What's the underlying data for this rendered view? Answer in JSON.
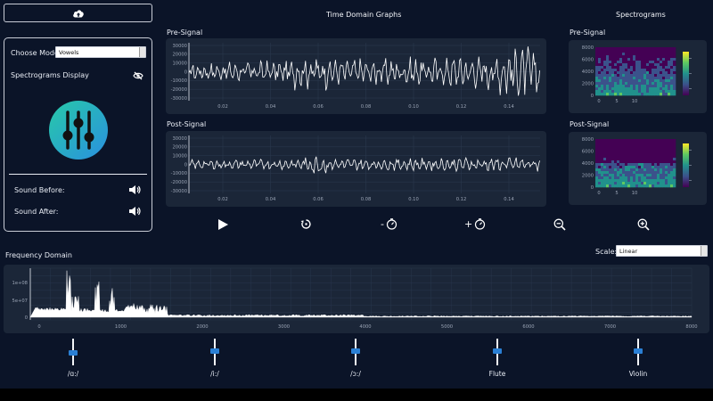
{
  "toolbar": {
    "upload_icon": "cloud-upload-icon"
  },
  "side": {
    "mode_label": "Choose Mode:",
    "mode_value": "Vowels",
    "spectrogram_toggle_label": "Spectrograms Display",
    "spectrogram_toggle_icon": "eye-off-icon",
    "app_icon": "equalizer-sliders-icon",
    "sound_before_label": "Sound Before:",
    "sound_after_label": "Sound After:",
    "speaker_icon": "speaker-icon"
  },
  "time_domain": {
    "title": "Time Domain Graphs",
    "pre_label": "Pre-Signal",
    "post_label": "Post-Signal",
    "y_ticks": [
      "30000",
      "20000",
      "10000",
      "0",
      "-10000",
      "-20000",
      "-30000"
    ],
    "x_ticks": [
      "0.02",
      "0.04",
      "0.06",
      "0.08",
      "0.10",
      "0.12",
      "0.14"
    ]
  },
  "spectrograms": {
    "title": "Spectrograms",
    "pre_label": "Pre-Signal",
    "post_label": "Post-Signal",
    "y_ticks": [
      "8000",
      "6000",
      "4000",
      "2000",
      "0"
    ],
    "x_ticks": [
      "0",
      "5",
      "10"
    ]
  },
  "controls": {
    "play_icon": "play-icon",
    "reset_icon": "reset-icon",
    "speed_down_label": "-",
    "speed_up_label": "+",
    "speed_icon": "speed-timer-icon",
    "zoom_out_icon": "zoom-out-icon",
    "zoom_in_icon": "zoom-in-icon"
  },
  "frequency": {
    "title": "Frequency Domain",
    "scale_label": "Scale:",
    "scale_value": "Linear",
    "y_ticks": [
      "1e+08",
      "5e+07",
      "0"
    ],
    "x_ticks": [
      "0",
      "1000",
      "2000",
      "3000",
      "4000",
      "5000",
      "6000",
      "7000",
      "8000"
    ]
  },
  "sliders": [
    {
      "label": "/ɑ:/",
      "level": 0.45
    },
    {
      "label": "/i:/",
      "level": 0.55
    },
    {
      "label": "/ɔ:/",
      "level": 0.55
    },
    {
      "label": "Flute",
      "level": 0.55
    },
    {
      "label": "Violin",
      "level": 0.55
    }
  ],
  "colors": {
    "background": "#0b1428",
    "panel": "#1b2638",
    "accent": "#2a7fd4",
    "signal": "#ffffff"
  }
}
